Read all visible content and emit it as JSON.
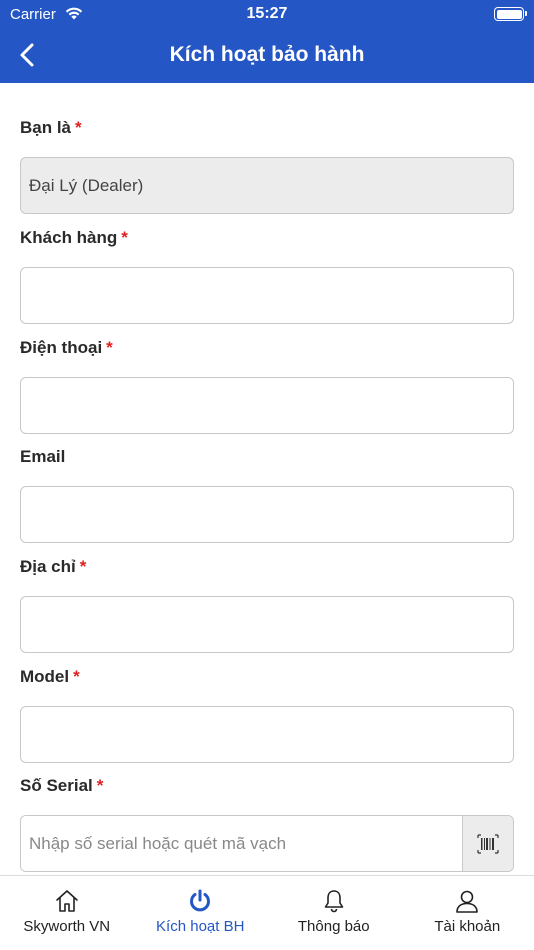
{
  "status_bar": {
    "carrier": "Carrier",
    "time": "15:27"
  },
  "nav": {
    "title": "Kích hoạt bảo hành"
  },
  "form": {
    "required_mark": "*",
    "role": {
      "label": "Bạn là",
      "value": "Đại Lý (Dealer)"
    },
    "customer": {
      "label": "Khách hàng",
      "value": ""
    },
    "phone": {
      "label": "Điện thoại",
      "value": ""
    },
    "email": {
      "label": "Email",
      "value": ""
    },
    "address": {
      "label": "Địa chỉ",
      "value": ""
    },
    "model": {
      "label": "Model",
      "value": ""
    },
    "serial": {
      "label": "Số Serial",
      "placeholder": "Nhập số serial hoặc quét mã vạch",
      "value": ""
    }
  },
  "tabs": [
    {
      "label": "Skyworth VN",
      "icon": "home-icon"
    },
    {
      "label": "Kích hoạt BH",
      "icon": "power-icon",
      "active": true
    },
    {
      "label": "Thông báo",
      "icon": "bell-icon"
    },
    {
      "label": "Tài khoản",
      "icon": "user-icon"
    }
  ],
  "colors": {
    "primary": "#2457c5",
    "required": "#e02020",
    "readonly_bg": "#ececec",
    "border": "#c8c8c8"
  }
}
